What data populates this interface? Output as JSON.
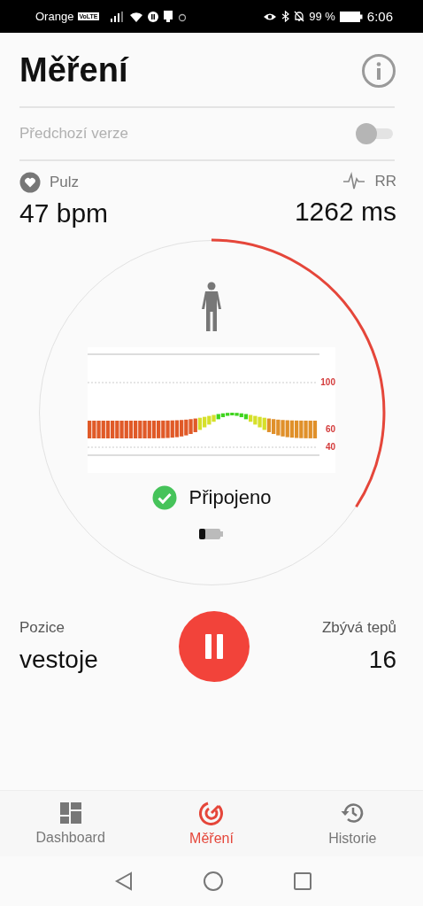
{
  "status_bar": {
    "carrier": "Orange",
    "volte_badge": "VoLTE",
    "battery_percent": "99 %",
    "time": "6:06"
  },
  "header": {
    "title": "Měření"
  },
  "previous_version": {
    "label": "Předchozí verze",
    "on": false
  },
  "pulse": {
    "label": "Pulz",
    "value": "47 bpm"
  },
  "rr": {
    "label": "RR",
    "value": "1262 ms"
  },
  "measurement": {
    "graph": {
      "tick_labels": [
        "100",
        "60",
        "40"
      ]
    },
    "connection": {
      "label": "Připojeno",
      "connected": true
    }
  },
  "position": {
    "label": "Pozice",
    "value": "vestoje"
  },
  "remaining": {
    "label": "Zbývá tepů",
    "value": "16"
  },
  "bottom_nav": [
    {
      "label": "Dashboard",
      "selected": false
    },
    {
      "label": "Měření",
      "selected": true
    },
    {
      "label": "Historie",
      "selected": false
    }
  ]
}
